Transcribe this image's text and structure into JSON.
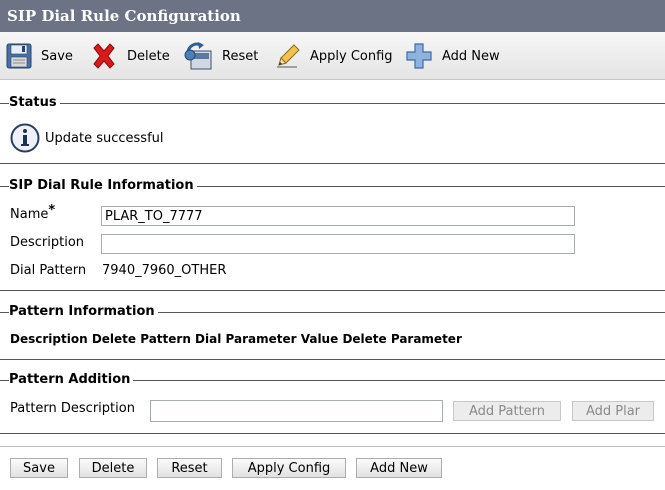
{
  "window": {
    "title": "SIP Dial Rule Configuration"
  },
  "toolbar": {
    "save_label": "Save",
    "delete_label": "Delete",
    "reset_label": "Reset",
    "apply_config_label": "Apply Config",
    "add_new_label": "Add New"
  },
  "status": {
    "legend": "Status",
    "message": "Update successful"
  },
  "rule_info": {
    "legend": "SIP Dial Rule Information",
    "name_label": "Name",
    "required_marker": "*",
    "name_value": "PLAR_TO_7777",
    "description_label": "Description",
    "description_value": "",
    "dial_pattern_label": "Dial Pattern",
    "dial_pattern_value": "7940_7960_OTHER"
  },
  "pattern_info": {
    "legend": "Pattern Information",
    "columns": [
      "Description",
      "Delete Pattern",
      "Dial Parameter",
      "Value",
      "Delete Parameter"
    ]
  },
  "pattern_addition": {
    "legend": "Pattern Addition",
    "pattern_description_label": "Pattern Description",
    "pattern_description_value": "",
    "add_pattern_label": "Add Pattern",
    "add_plar_label": "Add Plar"
  },
  "bottom_buttons": {
    "save_label": "Save",
    "delete_label": "Delete",
    "reset_label": "Reset",
    "apply_config_label": "Apply Config",
    "add_new_label": "Add New"
  }
}
